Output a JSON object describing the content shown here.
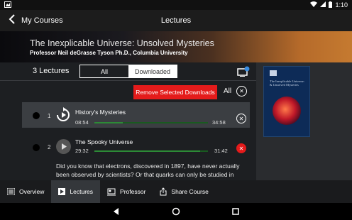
{
  "status_bar": {
    "time": "1:10",
    "icons": [
      "notification-icon",
      "wifi-icon",
      "signal-icon",
      "battery-icon"
    ]
  },
  "app_bar": {
    "back_icon": "arrow-back-icon",
    "left_title": "My Courses",
    "center_title": "Lectures"
  },
  "hero": {
    "course_title": "The Inexplicable Universe: Unsolved Mysteries",
    "professor": "Professor Neil deGrasse Tyson Ph.D., Columbia University"
  },
  "lectures": {
    "count_label": "3 Lectures",
    "filter_tabs": [
      "All",
      "Downloaded"
    ],
    "selected_filter": "All",
    "tv_badge": "1",
    "remove_button": "Remove Selected Downloads",
    "all_label": "All",
    "items": [
      {
        "number": "1",
        "title": "History's Mysteries",
        "elapsed": "08:54",
        "duration": "34:58",
        "progress": 0.25,
        "action_icon": "close-icon"
      },
      {
        "number": "2",
        "title": "The Spooky Universe",
        "elapsed": "29:32",
        "duration": "31:42",
        "progress": 0.93,
        "action_icon": "close-icon",
        "description": "Did you know that electrons, discovered in 1897, have never actually been observed by scientists? Or that quarks can only be studied in"
      }
    ]
  },
  "cover": {
    "title_line": "The Inexplicable Universe: & Unsolved Mysteries"
  },
  "bottom_tabs": [
    {
      "label": "Overview",
      "icon": "list-icon"
    },
    {
      "label": "Lectures",
      "icon": "play-icon"
    },
    {
      "label": "Professor",
      "icon": "professor-icon"
    },
    {
      "label": "Share Course",
      "icon": "share-icon"
    }
  ],
  "active_tab": "Lectures",
  "colors": {
    "accent_red": "#e41b1b",
    "progress_green": "#2c8a36",
    "panel_bg": "#1d1f22"
  }
}
